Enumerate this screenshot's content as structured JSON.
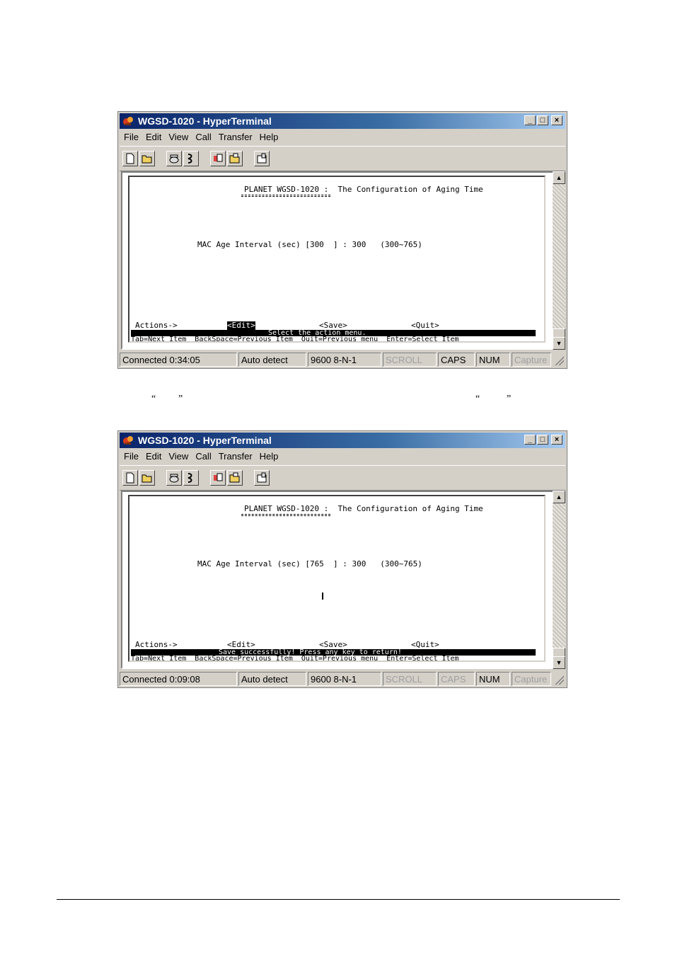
{
  "windows": [
    {
      "title": "WGSD-1020 - HyperTerminal",
      "menu": [
        "File",
        "Edit",
        "View",
        "Call",
        "Transfer",
        "Help"
      ],
      "terminal": {
        "header": "PLANET WGSD-1020 :  The Configuration of Aging Time",
        "mac_line": "MAC Age Interval (sec) [300  ] : 300   (300~765)",
        "actions_label": "Actions->",
        "edit": "<Edit>",
        "save": "<Save>",
        "quit": "<Quit>",
        "message": "Select the action menu.",
        "help": "Tab=Next Item  BackSpace=Previous Item  Quit=Previous menu  Enter=Select Item"
      },
      "status": {
        "connected": "Connected 0:34:05",
        "detect": "Auto detect",
        "port": "9600 8-N-1",
        "scroll": "SCROLL",
        "caps": "CAPS",
        "num": "NUM",
        "capture": "Capture"
      }
    },
    {
      "title": "WGSD-1020 - HyperTerminal",
      "menu": [
        "File",
        "Edit",
        "View",
        "Call",
        "Transfer",
        "Help"
      ],
      "terminal": {
        "header": "PLANET WGSD-1020 :  The Configuration of Aging Time",
        "mac_line": "MAC Age Interval (sec) [765  ] : 300   (300~765)",
        "actions_label": "Actions->",
        "edit": "<Edit>",
        "save": "<Save>",
        "quit": "<Quit>",
        "message": "Save successfully! Press any key to return!",
        "help": "Tab=Next Item  BackSpace=Previous Item  Quit=Previous menu  Enter=Select Item"
      },
      "status": {
        "connected": "Connected 0:09:08",
        "detect": "Auto detect",
        "port": "9600 8-N-1",
        "scroll": "SCROLL",
        "caps": "CAPS",
        "num": "NUM",
        "capture": "Capture"
      }
    }
  ],
  "quote_marks": [
    "“",
    "”",
    "“",
    "”"
  ]
}
